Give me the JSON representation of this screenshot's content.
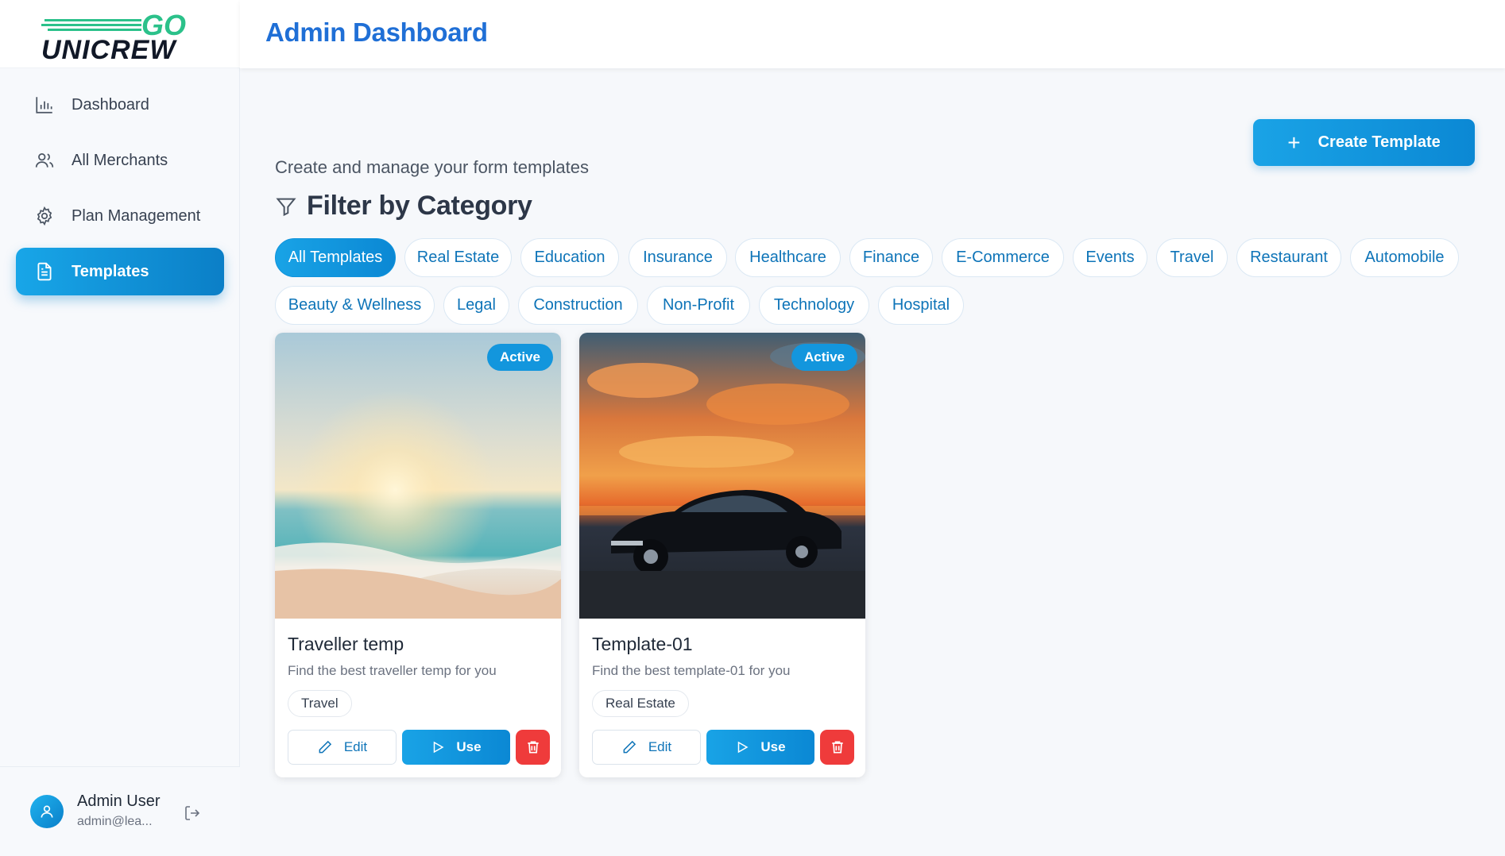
{
  "brand": {
    "logo_top": "GO",
    "logo_bottom": "UNICREW"
  },
  "header": {
    "title": "Admin Dashboard"
  },
  "sidebar": {
    "items": [
      {
        "label": "Dashboard",
        "icon": "bar-chart-icon",
        "active": false
      },
      {
        "label": "All Merchants",
        "icon": "users-icon",
        "active": false
      },
      {
        "label": "Plan Management",
        "icon": "gear-icon",
        "active": false
      },
      {
        "label": "Templates",
        "icon": "document-icon",
        "active": true
      }
    ]
  },
  "user": {
    "name": "Admin User",
    "email": "admin@lea..."
  },
  "main": {
    "create_button_label": "Create Template",
    "subtitle": "Create and manage your form templates",
    "filter_title": "Filter by Category",
    "categories": [
      "All Templates",
      "Real Estate",
      "Education",
      "Insurance",
      "Healthcare",
      "Finance",
      "E-Commerce",
      "Events",
      "Travel",
      "Restaurant",
      "Automobile",
      "Beauty & Wellness",
      "Legal",
      "Construction",
      "Non-Profit",
      "Technology",
      "Hospital"
    ],
    "selected_category": "All Templates",
    "templates": [
      {
        "status": "Active",
        "title": "Traveller temp",
        "description": "Find the best traveller temp for you",
        "category": "Travel",
        "image": "beach-sunset"
      },
      {
        "status": "Active",
        "title": "Template-01",
        "description": "Find the best template-01 for you",
        "category": "Real Estate",
        "image": "classic-car-sunset"
      }
    ],
    "actions": {
      "edit": "Edit",
      "use": "Use"
    }
  },
  "colors": {
    "accent": "#1396dd",
    "title": "#1f6fd6",
    "danger": "#ef3b3b"
  }
}
